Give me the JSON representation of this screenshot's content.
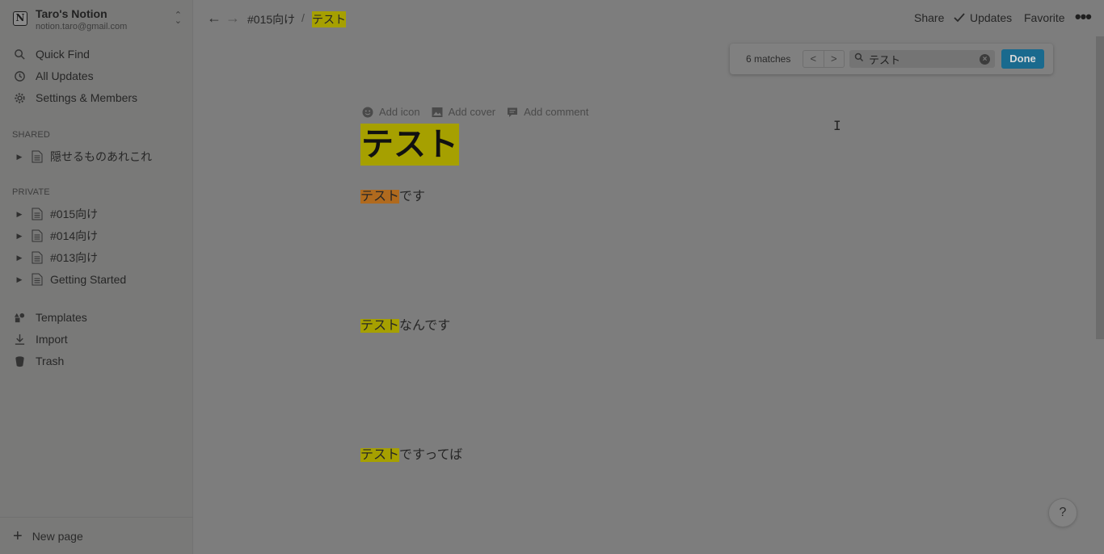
{
  "sidebar": {
    "workspace_name": "Taro's Notion",
    "workspace_email": "notion.taro@gmail.com",
    "workspace_logo": "N",
    "quick_find": "Quick Find",
    "all_updates": "All Updates",
    "settings": "Settings & Members",
    "shared_label": "SHARED",
    "shared_pages": [
      "隠せるものあれこれ"
    ],
    "private_label": "PRIVATE",
    "private_pages": [
      "#015向け",
      "#014向け",
      "#013向け",
      "Getting Started"
    ],
    "templates": "Templates",
    "import": "Import",
    "trash": "Trash",
    "new_page": "New page"
  },
  "topbar": {
    "breadcrumb_parent": "#015向け",
    "breadcrumb_sep": "/",
    "breadcrumb_current": "テスト",
    "share": "Share",
    "updates": "Updates",
    "favorite": "Favorite",
    "more": "•••"
  },
  "find": {
    "matches": "6 matches",
    "prev": "<",
    "next": ">",
    "query": "テスト",
    "done": "Done"
  },
  "page": {
    "add_icon": "Add icon",
    "add_cover": "Add cover",
    "add_comment": "Add comment",
    "title": "テスト",
    "blocks": [
      {
        "match": "テスト",
        "rest": "です"
      },
      {
        "match": "テスト",
        "rest": "なんです"
      },
      {
        "match": "テスト",
        "rest": "ですってば"
      }
    ]
  },
  "help": "?",
  "colors": {
    "match_highlight": "#a6a000",
    "current_match": "#b06a1e",
    "done_button": "#1a6a8e"
  }
}
